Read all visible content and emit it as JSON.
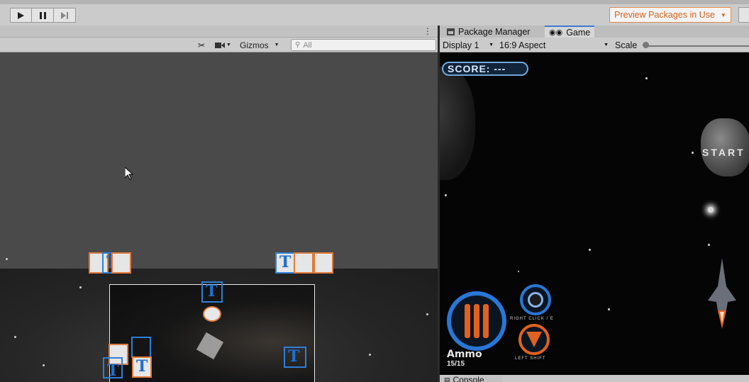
{
  "toolbar": {
    "play_icon": "play-icon",
    "pause_icon": "pause-icon",
    "step_icon": "step-icon",
    "preview_packages_label": "Preview Packages in Use",
    "preview_packages_color": "#d0621c"
  },
  "scene": {
    "tools": {
      "gizmos_label": "Gizmos",
      "search_placeholder": "All"
    }
  },
  "game_panel": {
    "tabs": [
      {
        "label": "Package Manager",
        "icon": "package-icon"
      },
      {
        "label": "Game",
        "icon": "gamepad-icon"
      }
    ],
    "display_label": "Display 1",
    "aspect_label": "16:9 Aspect",
    "scale_label": "Scale",
    "hud": {
      "score_text": "SCORE: ---",
      "start_text": "START",
      "ammo_label": "Ammo",
      "ammo_count": "15/15",
      "right_click_label": "RIGHT CLICK / E",
      "left_shift_label": "LEFT SHIFT"
    }
  },
  "console": {
    "label": "Console"
  },
  "colors": {
    "accent_blue": "#2877d6",
    "accent_orange": "#e0621e"
  }
}
